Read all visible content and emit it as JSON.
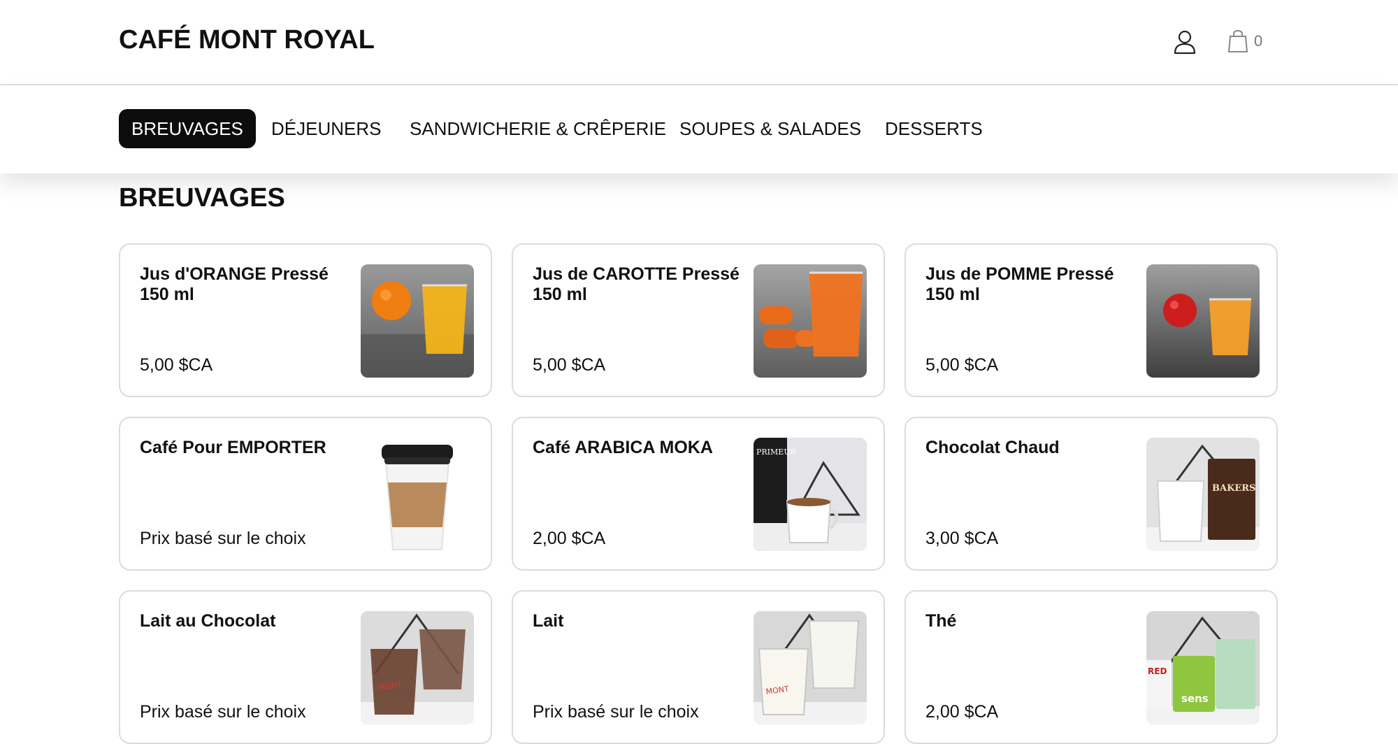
{
  "header": {
    "brand": "CAFÉ MONT ROYAL",
    "user_icon": "user-icon",
    "cart_icon": "shopping-bag-icon",
    "cart_count": "0"
  },
  "nav": {
    "tabs": [
      {
        "label": "BREUVAGES",
        "active": true
      },
      {
        "label": "DÉJEUNERS",
        "active": false
      },
      {
        "label": "SANDWICHERIE & CRÊPERIE",
        "active": false
      },
      {
        "label": "SOUPES & SALADES",
        "active": false
      },
      {
        "label": "DESSERTS",
        "active": false
      }
    ]
  },
  "section": {
    "title": "BREUVAGES"
  },
  "products": [
    {
      "name": "Jus d'ORANGE Pressé 150 ml",
      "price": "5,00 $CA",
      "image": "orange-juice-photo"
    },
    {
      "name": "Jus de CAROTTE Pressé 150 ml",
      "price": "5,00 $CA",
      "image": "carrot-juice-photo"
    },
    {
      "name": "Jus de POMME Pressé 150 ml",
      "price": "5,00 $CA",
      "image": "apple-juice-photo"
    },
    {
      "name": "Café Pour EMPORTER",
      "price": "Prix basé sur le choix",
      "image": "takeaway-coffee-cup-photo"
    },
    {
      "name": "Café ARABICA MOKA",
      "price": "2,00 $CA",
      "image": "arabica-coffee-photo",
      "image_text": "PRIMEUR"
    },
    {
      "name": "Chocolat Chaud",
      "price": "3,00 $CA",
      "image": "hot-chocolate-photo",
      "image_text": "BAKERS"
    },
    {
      "name": "Lait au Chocolat",
      "price": "Prix basé sur le choix",
      "image": "chocolate-milk-photo"
    },
    {
      "name": "Lait",
      "price": "Prix basé sur le choix",
      "image": "milk-photo"
    },
    {
      "name": "Thé",
      "price": "2,00 $CA",
      "image": "tea-photo",
      "image_text": "sens"
    }
  ],
  "colors": {
    "active_tab_bg": "#0c0c0c",
    "active_tab_text": "#ffffff",
    "card_border": "#dcdcdc",
    "text": "#111111",
    "cart_count": "#777777"
  }
}
